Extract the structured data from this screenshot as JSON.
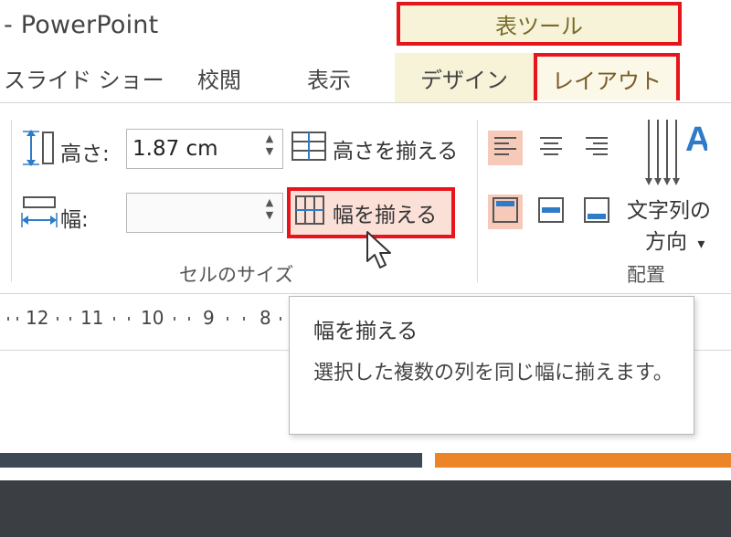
{
  "title_bar": {
    "app_title": "- PowerPoint",
    "context_header": "表ツール"
  },
  "tabs": [
    {
      "label": "スライド ショー"
    },
    {
      "label": "校閲"
    },
    {
      "label": "表示"
    },
    {
      "label": "デザイン"
    },
    {
      "label": "レイアウト"
    }
  ],
  "cell_size_group": {
    "height_label": "高さ:",
    "height_value": "1.87 cm",
    "width_label": "幅:",
    "width_value": "",
    "distribute_rows_label": "高さを揃える",
    "distribute_columns_label": "幅を揃える",
    "group_label": "セルのサイズ"
  },
  "alignment_group": {
    "text_direction_line1": "文字列の",
    "text_direction_line2": "方向",
    "text_direction_glyph": "A",
    "group_label": "配置",
    "dropdown_arrow": "▾"
  },
  "ruler": {
    "numbers": [
      "12",
      "11",
      "10",
      "9",
      "8"
    ]
  },
  "tooltip": {
    "title": "幅を揃える",
    "description": "選択した複数の列を同じ幅に揃えます。"
  },
  "colors": {
    "highlight_red": "#e8141b",
    "context_yellow": "#f6f3d9",
    "active_salmon": "#f6c9b9",
    "bar_orange": "#eb8528",
    "bar_gray": "#3d4a56"
  },
  "icons": {
    "spinner_up": "▲",
    "spinner_down": "▼"
  }
}
